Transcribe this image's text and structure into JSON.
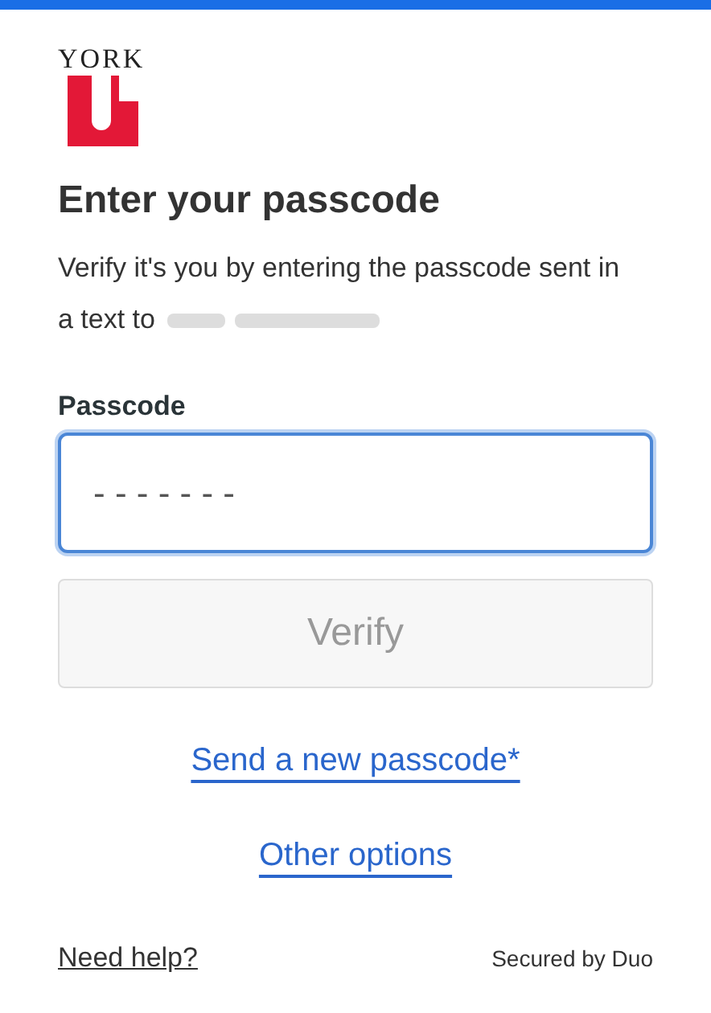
{
  "logo": {
    "text": "YORK"
  },
  "heading": "Enter your passcode",
  "instructions": [
    "Verify it's you by entering the passcode sent in",
    "a text to"
  ],
  "passcode": {
    "label": "Passcode",
    "placeholder": "- - - - - - -",
    "focused": true
  },
  "verify_button": {
    "label": "Verify",
    "disabled": true
  },
  "links": [
    "Send a new passcode*",
    "Other options"
  ],
  "footer": {
    "help": "Need help?",
    "secured": "Secured by Duo"
  }
}
